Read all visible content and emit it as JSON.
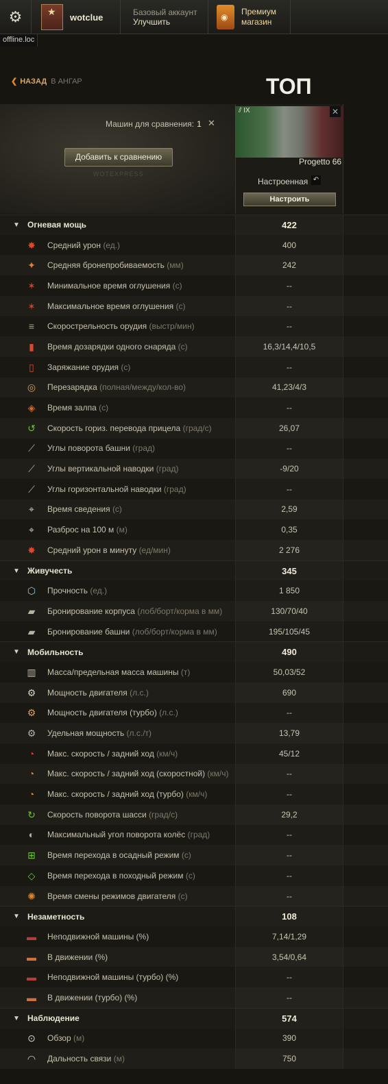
{
  "header": {
    "settings_icon": "gear-icon",
    "username": "wotclue",
    "account_line1": "Базовый аккаунт",
    "account_line2": "Улучшить",
    "premium_line1": "Премиум",
    "premium_line2": "магазин",
    "server": "offline.loc"
  },
  "nav": {
    "back": "НАЗАД",
    "back_sub": "В АНГАР",
    "title": "ТОП"
  },
  "compare": {
    "count_label": "Машин для сравнения:",
    "count": "1",
    "add_button": "Добавить к сравнению",
    "watermark": "WOTEXPRESS"
  },
  "vehicle": {
    "tier": "IX",
    "name": "Progetto 66",
    "state": "Настроенная",
    "setup_button": "Настроить",
    "flag_colors": [
      "#2f6b35",
      "#a8b2a6",
      "#7a3638"
    ]
  },
  "sections": [
    {
      "name": "Огневая мощь",
      "value": "422",
      "rows": [
        {
          "icon": "damage-icon",
          "glyph": "✸",
          "color": "#e0462a",
          "label": "Средний урон",
          "unit": "(ед.)",
          "value": "400"
        },
        {
          "icon": "penetration-icon",
          "glyph": "✦",
          "color": "#e47c3a",
          "label": "Средняя бронепробиваемость",
          "unit": "(мм)",
          "value": "242"
        },
        {
          "icon": "stun-min-icon",
          "glyph": "✶",
          "color": "#c9452c",
          "label": "Минимальное время оглушения",
          "unit": "(с)",
          "value": "--"
        },
        {
          "icon": "stun-max-icon",
          "glyph": "✶",
          "color": "#c9452c",
          "label": "Максимальное время оглушения",
          "unit": "(с)",
          "value": "--"
        },
        {
          "icon": "rate-of-fire-icon",
          "glyph": "≡",
          "color": "#a8a292",
          "label": "Скорострельность орудия",
          "unit": "(выстр/мин)",
          "value": "--"
        },
        {
          "icon": "shell-reload-icon",
          "glyph": "▮",
          "color": "#d84a2e",
          "label": "Время дозарядки одного снаряда",
          "unit": "(с)",
          "value": "16,3/14,4/10,5"
        },
        {
          "icon": "gun-loading-icon",
          "glyph": "▯",
          "color": "#d84a2e",
          "label": "Заряжание орудия",
          "unit": "(с)",
          "value": "--"
        },
        {
          "icon": "reload-icon",
          "glyph": "◎",
          "color": "#d0a060",
          "label": "Перезарядка",
          "unit": "(полная/между/кол-во)",
          "value": "41,23/4/3"
        },
        {
          "icon": "salvo-icon",
          "glyph": "◈",
          "color": "#d06a2c",
          "label": "Время залпа",
          "unit": "(с)",
          "value": "--"
        },
        {
          "icon": "traverse-icon",
          "glyph": "↺",
          "color": "#6fc23a",
          "label": "Скорость гориз. перевода прицела",
          "unit": "(град/с)",
          "value": "26,07"
        },
        {
          "icon": "turret-angles-icon",
          "glyph": "⟋",
          "color": "#b8b2a2",
          "label": "Углы поворота башни",
          "unit": "(град)",
          "value": "--"
        },
        {
          "icon": "elevation-icon",
          "glyph": "⟋",
          "color": "#b8b2a2",
          "label": "Углы вертикальной наводки",
          "unit": "(град)",
          "value": "-9/20"
        },
        {
          "icon": "horizontal-angles-icon",
          "glyph": "⟋",
          "color": "#b8b2a2",
          "label": "Углы горизонтальной наводки",
          "unit": "(град)",
          "value": "--"
        },
        {
          "icon": "aim-time-icon",
          "glyph": "⌖",
          "color": "#d8d2c2",
          "label": "Время сведения",
          "unit": "(с)",
          "value": "2,59"
        },
        {
          "icon": "dispersion-icon",
          "glyph": "⌖",
          "color": "#d8d2c2",
          "label": "Разброс на 100 м",
          "unit": "(м)",
          "value": "0,35"
        },
        {
          "icon": "dpm-icon",
          "glyph": "✸",
          "color": "#e0462a",
          "label": "Средний урон в минуту",
          "unit": "(ед/мин)",
          "value": "2 276"
        }
      ]
    },
    {
      "name": "Живучесть",
      "value": "345",
      "rows": [
        {
          "icon": "hp-icon",
          "glyph": "⬡",
          "color": "#9fc6d6",
          "label": "Прочность",
          "unit": "(ед.)",
          "value": "1 850"
        },
        {
          "icon": "hull-armor-icon",
          "glyph": "▰",
          "color": "#b8b2a2",
          "label": "Бронирование корпуса",
          "unit": "(лоб/борт/корма в мм)",
          "value": "130/70/40"
        },
        {
          "icon": "turret-armor-icon",
          "glyph": "▰",
          "color": "#b8b2a2",
          "label": "Бронирование башни",
          "unit": "(лоб/борт/корма в мм)",
          "value": "195/105/45"
        }
      ]
    },
    {
      "name": "Мобильность",
      "value": "490",
      "rows": [
        {
          "icon": "weight-icon",
          "glyph": "▥",
          "color": "#b8b2a2",
          "label": "Масса/предельная масса машины",
          "unit": "(т)",
          "value": "50,03/52"
        },
        {
          "icon": "engine-power-icon",
          "glyph": "⚙",
          "color": "#d8d2c2",
          "label": "Мощность двигателя",
          "unit": "(л.с.)",
          "value": "690"
        },
        {
          "icon": "engine-turbo-icon",
          "glyph": "⚙",
          "color": "#d8a060",
          "label": "Мощность двигателя (турбо)",
          "unit": "(л.с.)",
          "value": "--"
        },
        {
          "icon": "power-ratio-icon",
          "glyph": "⚙",
          "color": "#b8b2a2",
          "label": "Удельная мощность",
          "unit": "(л.с./т)",
          "value": "13,79"
        },
        {
          "icon": "speed-icon",
          "glyph": "◔",
          "color": "#d8403a",
          "label": "Макс. скорость / задний ход",
          "unit": "(км/ч)",
          "value": "45/12"
        },
        {
          "icon": "speed-fast-icon",
          "glyph": "◔",
          "color": "#e0862a",
          "label": "Макс. скорость / задний ход (скоростной)",
          "unit": "(км/ч)",
          "value": "--"
        },
        {
          "icon": "speed-turbo-icon",
          "glyph": "◔",
          "color": "#e0862a",
          "label": "Макс. скорость / задний ход (турбо)",
          "unit": "(км/ч)",
          "value": "--"
        },
        {
          "icon": "hull-traverse-icon",
          "glyph": "↻",
          "color": "#6fc23a",
          "label": "Скорость поворота шасси",
          "unit": "(град/с)",
          "value": "29,2"
        },
        {
          "icon": "wheel-angle-icon",
          "glyph": "◐",
          "color": "#b8b2a2",
          "label": "Максимальный угол поворота колёс",
          "unit": "(град)",
          "value": "--"
        },
        {
          "icon": "siege-mode-icon",
          "glyph": "⊞",
          "color": "#6fc23a",
          "label": "Время перехода в осадный режим",
          "unit": "(с)",
          "value": "--"
        },
        {
          "icon": "travel-mode-icon",
          "glyph": "◇",
          "color": "#6fc23a",
          "label": "Время перехода в походный режим",
          "unit": "(с)",
          "value": "--"
        },
        {
          "icon": "engine-mode-icon",
          "glyph": "✺",
          "color": "#e0862a",
          "label": "Время смены режимов двигателя",
          "unit": "(с)",
          "value": "--"
        }
      ]
    },
    {
      "name": "Незаметность",
      "value": "108",
      "rows": [
        {
          "icon": "camo-still-icon",
          "glyph": "▬",
          "color": "#b04040",
          "label": "Неподвижной машины (%)",
          "unit": "",
          "value": "7,14/1,29"
        },
        {
          "icon": "camo-moving-icon",
          "glyph": "▬",
          "color": "#d0703a",
          "label": "В движении (%)",
          "unit": "",
          "value": "3,54/0,64"
        },
        {
          "icon": "camo-still-turbo-icon",
          "glyph": "▬",
          "color": "#b04040",
          "label": "Неподвижной машины (турбо) (%)",
          "unit": "",
          "value": "--"
        },
        {
          "icon": "camo-moving-turbo-icon",
          "glyph": "▬",
          "color": "#d0703a",
          "label": "В движении (турбо) (%)",
          "unit": "",
          "value": "--"
        }
      ]
    },
    {
      "name": "Наблюдение",
      "value": "574",
      "rows": [
        {
          "icon": "view-range-icon",
          "glyph": "⊙",
          "color": "#d8d2c2",
          "label": "Обзор",
          "unit": "(м)",
          "value": "390"
        },
        {
          "icon": "radio-range-icon",
          "glyph": "◠",
          "color": "#d8d2c2",
          "label": "Дальность связи",
          "unit": "(м)",
          "value": "750"
        }
      ]
    }
  ]
}
